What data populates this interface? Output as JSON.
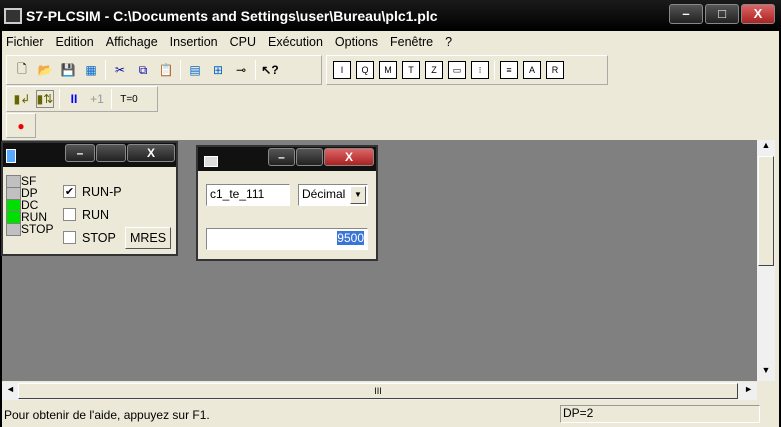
{
  "window": {
    "title": "S7-PLCSIM - C:\\Documents and Settings\\user\\Bureau\\plc1.plc",
    "minimize": "–",
    "maximize": "□",
    "close": "X"
  },
  "menu": [
    "Fichier",
    "Edition",
    "Affichage",
    "Insertion",
    "CPU",
    "Exécution",
    "Options",
    "Fenêtre",
    "?"
  ],
  "toolbar2": {
    "pause": "II",
    "step": "+1",
    "reset_timers": "T=0"
  },
  "cpu_window": {
    "leds": [
      {
        "label": "SF",
        "on": false
      },
      {
        "label": "DP",
        "on": false
      },
      {
        "label": "DC",
        "on": true
      },
      {
        "label": "RUN",
        "on": true
      },
      {
        "label": "STOP",
        "on": false
      }
    ],
    "modes": [
      {
        "label": "RUN-P",
        "checked": true
      },
      {
        "label": "RUN",
        "checked": false
      },
      {
        "label": "STOP",
        "checked": false
      }
    ],
    "mres": "MRES",
    "check": "✔"
  },
  "var_window": {
    "address": "c1_te_111",
    "format": "Décimal",
    "value": "9500"
  },
  "scroll": {
    "h_label": "III",
    "left": "◄",
    "right": "►",
    "up": "▲",
    "down": "▼"
  },
  "status": {
    "help": "Pour obtenir de l'aide, appuyez sur F1.",
    "dp": "DP=2"
  }
}
